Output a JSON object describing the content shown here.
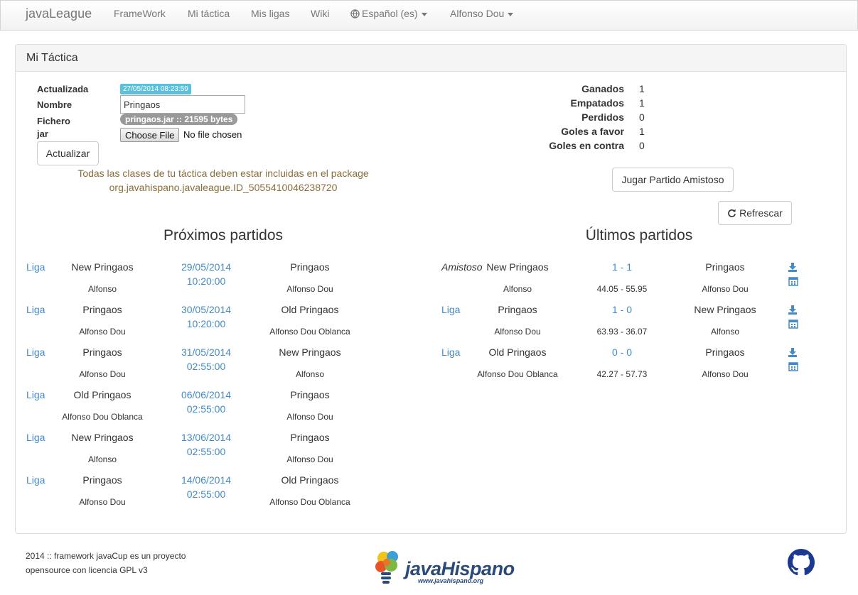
{
  "navbar": {
    "brand": "javaLeague",
    "items": [
      "FrameWork",
      "Mi táctica",
      "Mis ligas",
      "Wiki"
    ],
    "language": "Español (es)",
    "user": "Alfonso Dou"
  },
  "panel": {
    "title": "Mi Táctica",
    "form": {
      "updated_label": "Actualizada",
      "updated_value": "27/05/2014 08:23:59",
      "name_label": "Nombre",
      "name_value": "Pringaos",
      "file_label_1": "Fichero",
      "file_label_2": "jar",
      "file_badge": "pringaos.jar :: 21595 bytes",
      "choose_file": "Choose File",
      "no_file": "No file chosen",
      "submit": "Actualizar",
      "warning_line1": "Todas las clases de tu táctica deben estar incluidas en el package",
      "warning_line2": "org.javahispano.javaleague.ID_5055410046238720"
    },
    "stats": [
      {
        "label": "Ganados",
        "value": "1"
      },
      {
        "label": "Empatados",
        "value": "1"
      },
      {
        "label": "Perdidos",
        "value": "0"
      },
      {
        "label": "Goles a favor",
        "value": "1"
      },
      {
        "label": "Goles en contra",
        "value": "0"
      }
    ],
    "friendly_button": "Jugar Partido Amistoso",
    "refresh_button": "Refrescar",
    "upcoming": {
      "title": "Próximos partidos",
      "matches": [
        {
          "type": "Liga",
          "home": "New Pringaos",
          "home_user": "Alfonso",
          "date": "29/05/2014",
          "time": "10:20:00",
          "away": "Pringaos",
          "away_user": "Alfonso Dou"
        },
        {
          "type": "Liga",
          "home": "Pringaos",
          "home_user": "Alfonso Dou",
          "date": "30/05/2014",
          "time": "10:20:00",
          "away": "Old Pringaos",
          "away_user": "Alfonso Dou Oblanca"
        },
        {
          "type": "Liga",
          "home": "Pringaos",
          "home_user": "Alfonso Dou",
          "date": "31/05/2014",
          "time": "02:55:00",
          "away": "New Pringaos",
          "away_user": "Alfonso"
        },
        {
          "type": "Liga",
          "home": "Old Pringaos",
          "home_user": "Alfonso Dou Oblanca",
          "date": "06/06/2014",
          "time": "02:55:00",
          "away": "Pringaos",
          "away_user": "Alfonso Dou"
        },
        {
          "type": "Liga",
          "home": "New Pringaos",
          "home_user": "Alfonso",
          "date": "13/06/2014",
          "time": "02:55:00",
          "away": "Pringaos",
          "away_user": "Alfonso Dou"
        },
        {
          "type": "Liga",
          "home": "Pringaos",
          "home_user": "Alfonso Dou",
          "date": "14/06/2014",
          "time": "02:55:00",
          "away": "Old Pringaos",
          "away_user": "Alfonso Dou Oblanca"
        }
      ]
    },
    "recent": {
      "title": "Últimos partidos",
      "matches": [
        {
          "type": "Amistoso",
          "home": "New Pringaos",
          "home_user": "Alfonso",
          "score": "1 - 1",
          "possession": "44.05 - 55.95",
          "away": "Pringaos",
          "away_user": "Alfonso Dou"
        },
        {
          "type": "Liga",
          "home": "Pringaos",
          "home_user": "Alfonso Dou",
          "score": "1 - 0",
          "possession": "63.93 - 36.07",
          "away": "New Pringaos",
          "away_user": "Alfonso"
        },
        {
          "type": "Liga",
          "home": "Old Pringaos",
          "home_user": "Alfonso Dou Oblanca",
          "score": "0 - 0",
          "possession": "42.27 - 57.73",
          "away": "Pringaos",
          "away_user": "Alfonso Dou"
        }
      ]
    }
  },
  "footer": {
    "line1": "2014 :: framework javaCup es un proyecto",
    "line2": "opensource con licencia GPL v3",
    "logo_text": "javaHispano",
    "logo_url": "www.javahispano.org"
  },
  "colors": {
    "link": "#428bca",
    "info": "#5bc0de",
    "warning": "#8a6d3b"
  }
}
